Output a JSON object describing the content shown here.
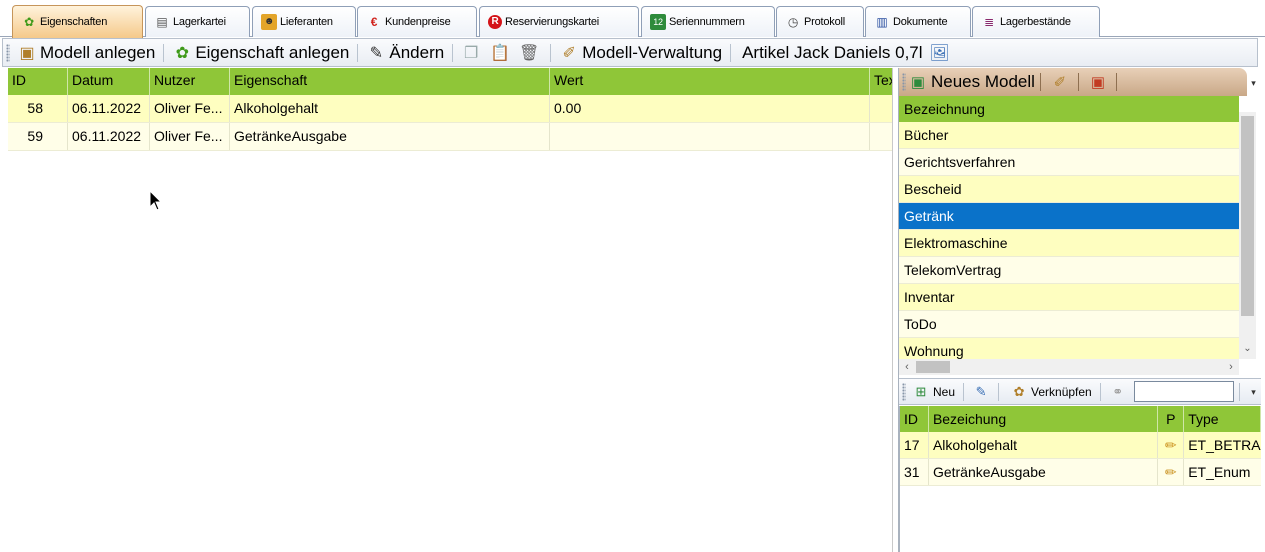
{
  "tabs": [
    {
      "label": "Eigenschaften",
      "icon": "gear-green-icon",
      "active": true
    },
    {
      "label": "Lagerkartei",
      "icon": "document-icon"
    },
    {
      "label": "Lieferanten",
      "icon": "person-card-icon"
    },
    {
      "label": "Kundenpreise",
      "icon": "euro-icon"
    },
    {
      "label": "Reservierungskartei",
      "icon": "r-circle-icon"
    },
    {
      "label": "Seriennummern",
      "icon": "serial-icon"
    },
    {
      "label": "Protokoll",
      "icon": "clock-icon"
    },
    {
      "label": "Dokumente",
      "icon": "binders-icon"
    },
    {
      "label": "Lagerbestände",
      "icon": "stack-icon"
    }
  ],
  "toolbar": {
    "modell_anlegen": "Modell anlegen",
    "eigenschaft_anlegen": "Eigenschaft anlegen",
    "aendern": "Ändern",
    "modell_verwaltung": "Modell-Verwaltung",
    "artikel": "Artikel Jack Daniels 0,7l"
  },
  "grid": {
    "headers": {
      "id": "ID",
      "datum": "Datum",
      "nutzer": "Nutzer",
      "eigenschaft": "Eigenschaft",
      "wert": "Wert",
      "text": "Tex"
    },
    "rows": [
      {
        "id": "58",
        "datum": "06.11.2022",
        "nutzer": "Oliver Fe...",
        "eigenschaft": "Alkoholgehalt",
        "wert": "0.00",
        "text": ""
      },
      {
        "id": "59",
        "datum": "06.11.2022",
        "nutzer": "Oliver Fe...",
        "eigenschaft": "GetränkeAusgabe",
        "wert": "",
        "text": ""
      }
    ]
  },
  "modell_panel": {
    "neues_modell": "Neues Modell",
    "header": "Bezeichnung",
    "items": [
      "Bücher",
      "Gerichtsverfahren",
      "Bescheid",
      "Getränk",
      "Elektromaschine",
      "TelekomVertrag",
      "Inventar",
      "ToDo",
      "Wohnung"
    ],
    "selected": "Getränk"
  },
  "property_panel": {
    "neu": "Neu",
    "verknuepfen": "Verknüpfen",
    "search_value": "",
    "headers": {
      "id": "ID",
      "bezeichnung": "Bezeichung",
      "p": "P",
      "type": "Type"
    },
    "rows": [
      {
        "id": "17",
        "bezeichnung": "Alkoholgehalt",
        "type": "ET_BETRAG"
      },
      {
        "id": "31",
        "bezeichnung": "GetränkeAusgabe",
        "type": "ET_Enum"
      }
    ]
  },
  "colors": {
    "header_green": "#8fc638",
    "row_yellow": "#fefec0",
    "row_light": "#fffee8",
    "selection_blue": "#0a72c9",
    "active_tab": "#f5c98a"
  }
}
